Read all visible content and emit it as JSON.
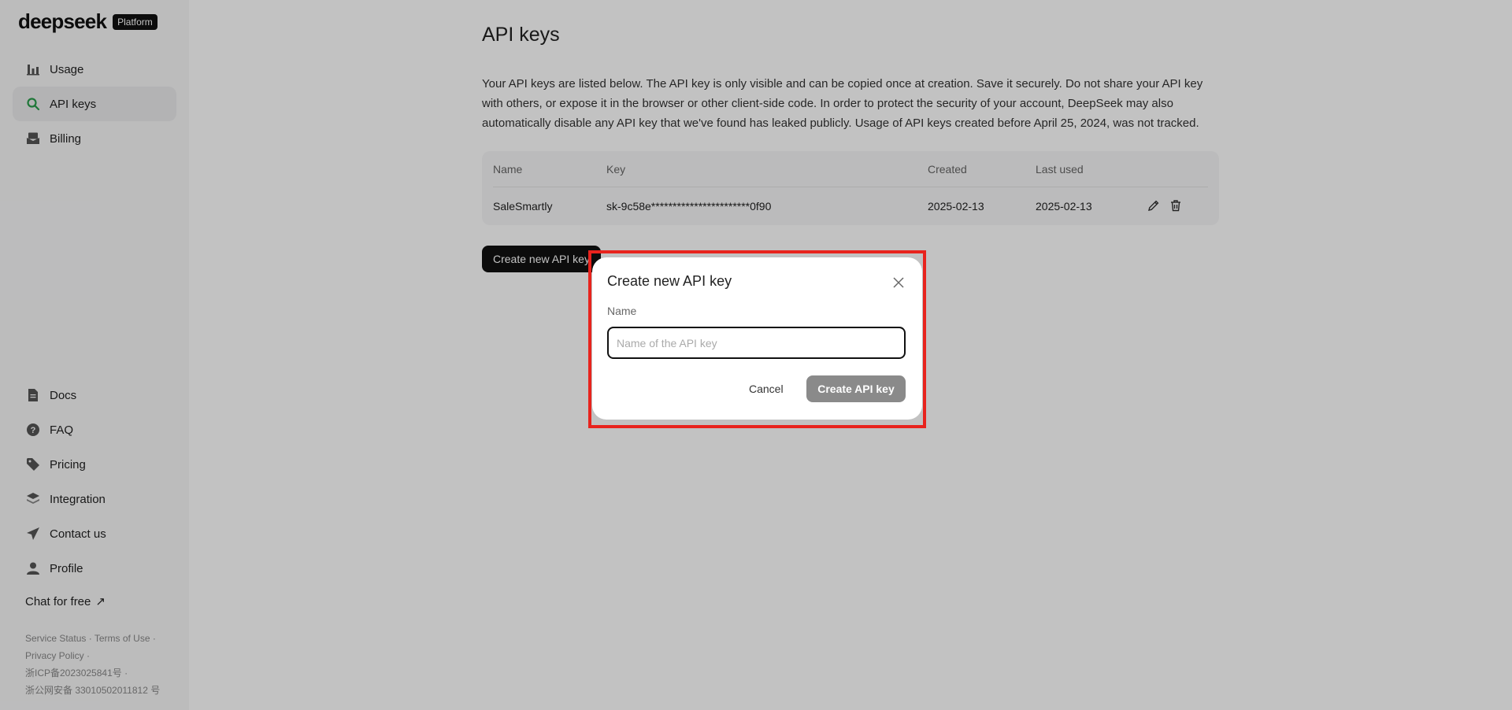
{
  "brand": {
    "name": "deepseek",
    "badge": "Platform"
  },
  "sidebar": {
    "items": [
      {
        "label": "Usage",
        "icon": "bar-chart-icon"
      },
      {
        "label": "API keys",
        "icon": "search-key-icon",
        "active": true
      },
      {
        "label": "Billing",
        "icon": "billing-icon"
      }
    ],
    "bottom_items": [
      {
        "label": "Docs",
        "icon": "document-icon"
      },
      {
        "label": "FAQ",
        "icon": "question-icon"
      },
      {
        "label": "Pricing",
        "icon": "tag-icon"
      },
      {
        "label": "Integration",
        "icon": "layers-icon"
      },
      {
        "label": "Contact us",
        "icon": "send-icon"
      },
      {
        "label": "Profile",
        "icon": "user-icon"
      }
    ],
    "chat_free": "Chat for free",
    "footer": {
      "service_status": "Service Status ·",
      "terms": "Terms of Use ·",
      "privacy": "Privacy Policy ·",
      "icp": "浙ICP备2023025841号 ·",
      "police": "浙公网安备 33010502011812 号"
    }
  },
  "main": {
    "title": "API keys",
    "intro": "Your API keys are listed below. The API key is only visible and can be copied once at creation. Save it securely. Do not share your API key with others, or expose it in the browser or other client-side code. In order to protect the security of your account, DeepSeek may also automatically disable any API key that we've found has leaked publicly. Usage of API keys created before April 25, 2024, was not tracked.",
    "table": {
      "headers": {
        "name": "Name",
        "key": "Key",
        "created": "Created",
        "last_used": "Last used"
      },
      "rows": [
        {
          "name": "SaleSmartly",
          "key": "sk-9c58e***********************0f90",
          "created": "2025-02-13",
          "last_used": "2025-02-13"
        }
      ]
    },
    "create_button": "Create new API key"
  },
  "dialog": {
    "title": "Create new API key",
    "name_label": "Name",
    "name_value": "",
    "name_placeholder": "Name of the API key",
    "cancel": "Cancel",
    "create": "Create API key"
  },
  "colors": {
    "highlight": "#e8231d",
    "active_icon": "#2a9d4b"
  }
}
